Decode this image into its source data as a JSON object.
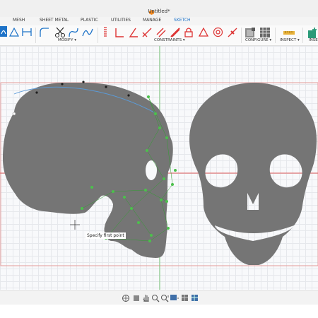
{
  "app": {
    "document_title": "Untitled*"
  },
  "tabs": [
    {
      "label": "MESH"
    },
    {
      "label": "SHEET METAL"
    },
    {
      "label": "PLASTIC"
    },
    {
      "label": "UTILITIES"
    },
    {
      "label": "MANAGE"
    },
    {
      "label": "SKETCH",
      "active": true
    }
  ],
  "toolbar": {
    "groups": [
      {
        "label": "MODIFY ▾"
      },
      {
        "label": "CONSTRAINTS ▾"
      },
      {
        "label": "CONFIGURE ▾"
      },
      {
        "label": "INSPECT ▾"
      },
      {
        "label": "INSE"
      }
    ]
  },
  "canvas": {
    "prompt": "Specify first point",
    "colors": {
      "shape": "#757575",
      "selected_points": "#4cc04c",
      "axis_red": "#e05a5a",
      "axis_green": "#6cc26c",
      "frame": "#e59a9a"
    }
  },
  "navbar": {
    "icons": [
      "orbit-icon",
      "look-at-icon",
      "pan-icon",
      "zoom-icon",
      "fit-icon",
      "display-style-icon",
      "grid-icon",
      "viewports-icon"
    ]
  }
}
